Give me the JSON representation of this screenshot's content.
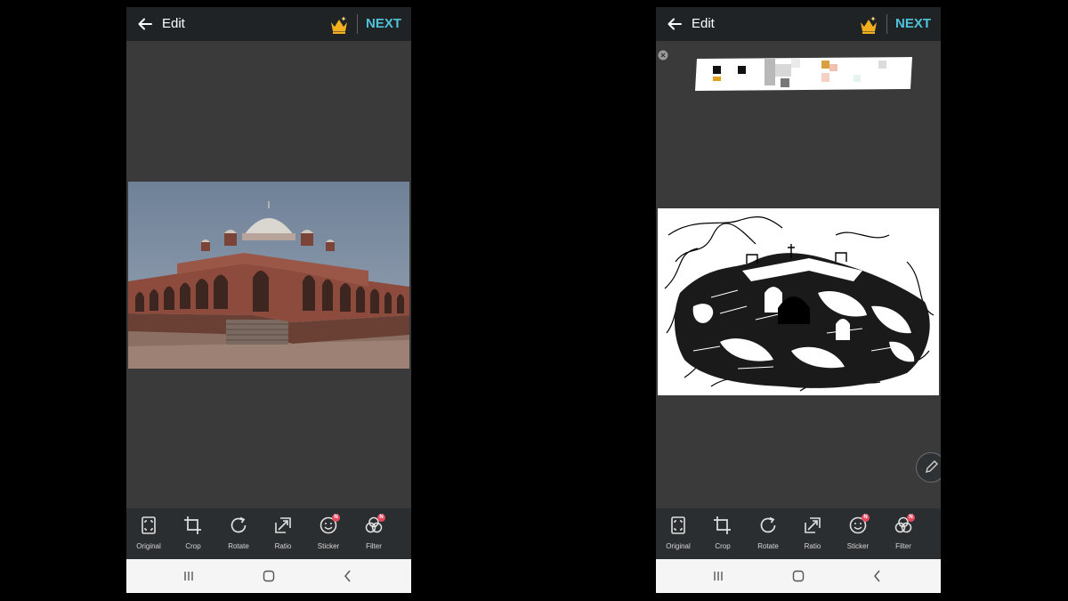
{
  "screens": [
    {
      "app_bar": {
        "title": "Edit",
        "next_label": "NEXT"
      },
      "tools": [
        {
          "label": "Original",
          "icon": "original-icon"
        },
        {
          "label": "Crop",
          "icon": "crop-icon"
        },
        {
          "label": "Rotate",
          "icon": "rotate-icon"
        },
        {
          "label": "Ratio",
          "icon": "ratio-icon"
        },
        {
          "label": "Sticker",
          "icon": "sticker-icon",
          "badge": "N"
        },
        {
          "label": "Filter",
          "icon": "filter-icon",
          "badge": "N"
        }
      ]
    },
    {
      "app_bar": {
        "title": "Edit",
        "next_label": "NEXT"
      },
      "tools": [
        {
          "label": "Original",
          "icon": "original-icon"
        },
        {
          "label": "Crop",
          "icon": "crop-icon"
        },
        {
          "label": "Rotate",
          "icon": "rotate-icon"
        },
        {
          "label": "Ratio",
          "icon": "ratio-icon"
        },
        {
          "label": "Sticker",
          "icon": "sticker-icon",
          "badge": "N"
        },
        {
          "label": "Filter",
          "icon": "filter-icon",
          "badge": "N"
        }
      ]
    }
  ],
  "colors": {
    "accent": "#4fc3d9",
    "crown": "#f2b01e",
    "badge": "#e84a5f",
    "canvas_bg": "#3a3a3a",
    "toolbar_bg": "#2b2e31"
  }
}
